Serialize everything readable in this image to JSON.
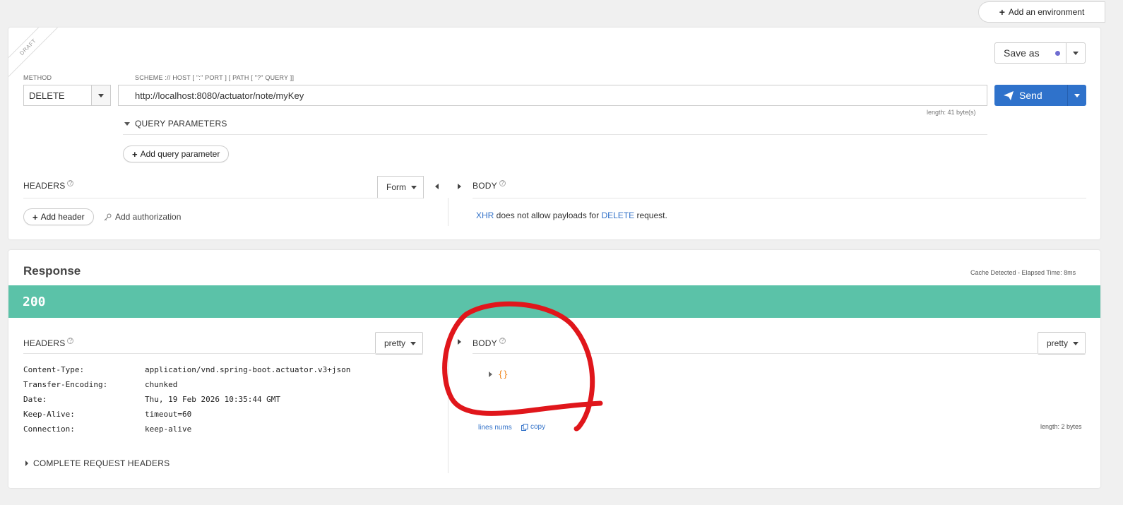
{
  "top": {
    "add_environment": "Add an environment"
  },
  "request": {
    "draft": "DRAFT",
    "method_label": "METHOD",
    "method_value": "DELETE",
    "url_label": "SCHEME :// HOST [ \":\" PORT ] [ PATH [ \"?\" QUERY ]]",
    "url_value": "http://localhost:8080/actuator/note/myKey",
    "length": "length: 41 byte(s)",
    "query_params": "QUERY PARAMETERS",
    "add_query": "Add query parameter",
    "save_as": "Save as",
    "send": "Send",
    "headers_title": "HEADERS",
    "headers_mode": "Form",
    "add_header": "Add header",
    "add_auth": "Add authorization",
    "body_title": "BODY",
    "body_msg": {
      "xhr": "XHR",
      "mid": " does not allow payloads for ",
      "method": "DELETE",
      "end": " request."
    }
  },
  "response": {
    "title": "Response",
    "meta": "Cache Detected - Elapsed Time: 8ms",
    "status": "200",
    "headers_title": "HEADERS",
    "headers_mode": "pretty",
    "headers": [
      {
        "key": "Content-Type:",
        "value": "application/vnd.spring-boot.actuator.v3+json"
      },
      {
        "key": "Transfer-Encoding:",
        "value": "chunked"
      },
      {
        "key": "Date:",
        "value": "Thu, 19 Feb 2026 10:35:44 GMT"
      },
      {
        "key": "Keep-Alive:",
        "value": "timeout=60"
      },
      {
        "key": "Connection:",
        "value": "keep-alive"
      }
    ],
    "complete_headers": "COMPLETE REQUEST HEADERS",
    "body_title": "BODY",
    "body_mode": "pretty",
    "body_value": "{}",
    "lines_nums": "lines nums",
    "copy": "copy",
    "length": "length: 2 bytes"
  },
  "annotation_color": "#e0161b"
}
